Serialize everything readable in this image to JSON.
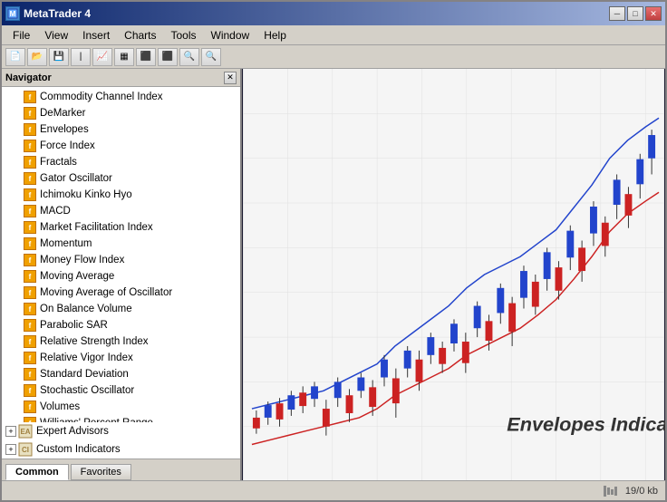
{
  "window": {
    "title": "MetaTrader 4"
  },
  "titlebar": {
    "minimize": "─",
    "restore": "□",
    "close": "✕"
  },
  "menu": {
    "items": [
      "File",
      "View",
      "Insert",
      "Charts",
      "Tools",
      "Window",
      "Help"
    ]
  },
  "navigator": {
    "title": "Navigator",
    "indicators": [
      "Commodity Channel Index",
      "DeMarker",
      "Envelopes",
      "Force Index",
      "Fractals",
      "Gator Oscillator",
      "Ichimoku Kinko Hyo",
      "MACD",
      "Market Facilitation Index",
      "Momentum",
      "Money Flow Index",
      "Moving Average",
      "Moving Average of Oscillator",
      "On Balance Volume",
      "Parabolic SAR",
      "Relative Strength Index",
      "Relative Vigor Index",
      "Standard Deviation",
      "Stochastic Oscillator",
      "Volumes",
      "Williams' Percent Range"
    ],
    "tree_items": [
      "Expert Advisors",
      "Custom Indicators"
    ]
  },
  "tabs": {
    "items": [
      "Common",
      "Favorites"
    ]
  },
  "chart": {
    "label": "Envelopes Indicator"
  },
  "statusbar": {
    "size": "19/0 kb"
  }
}
